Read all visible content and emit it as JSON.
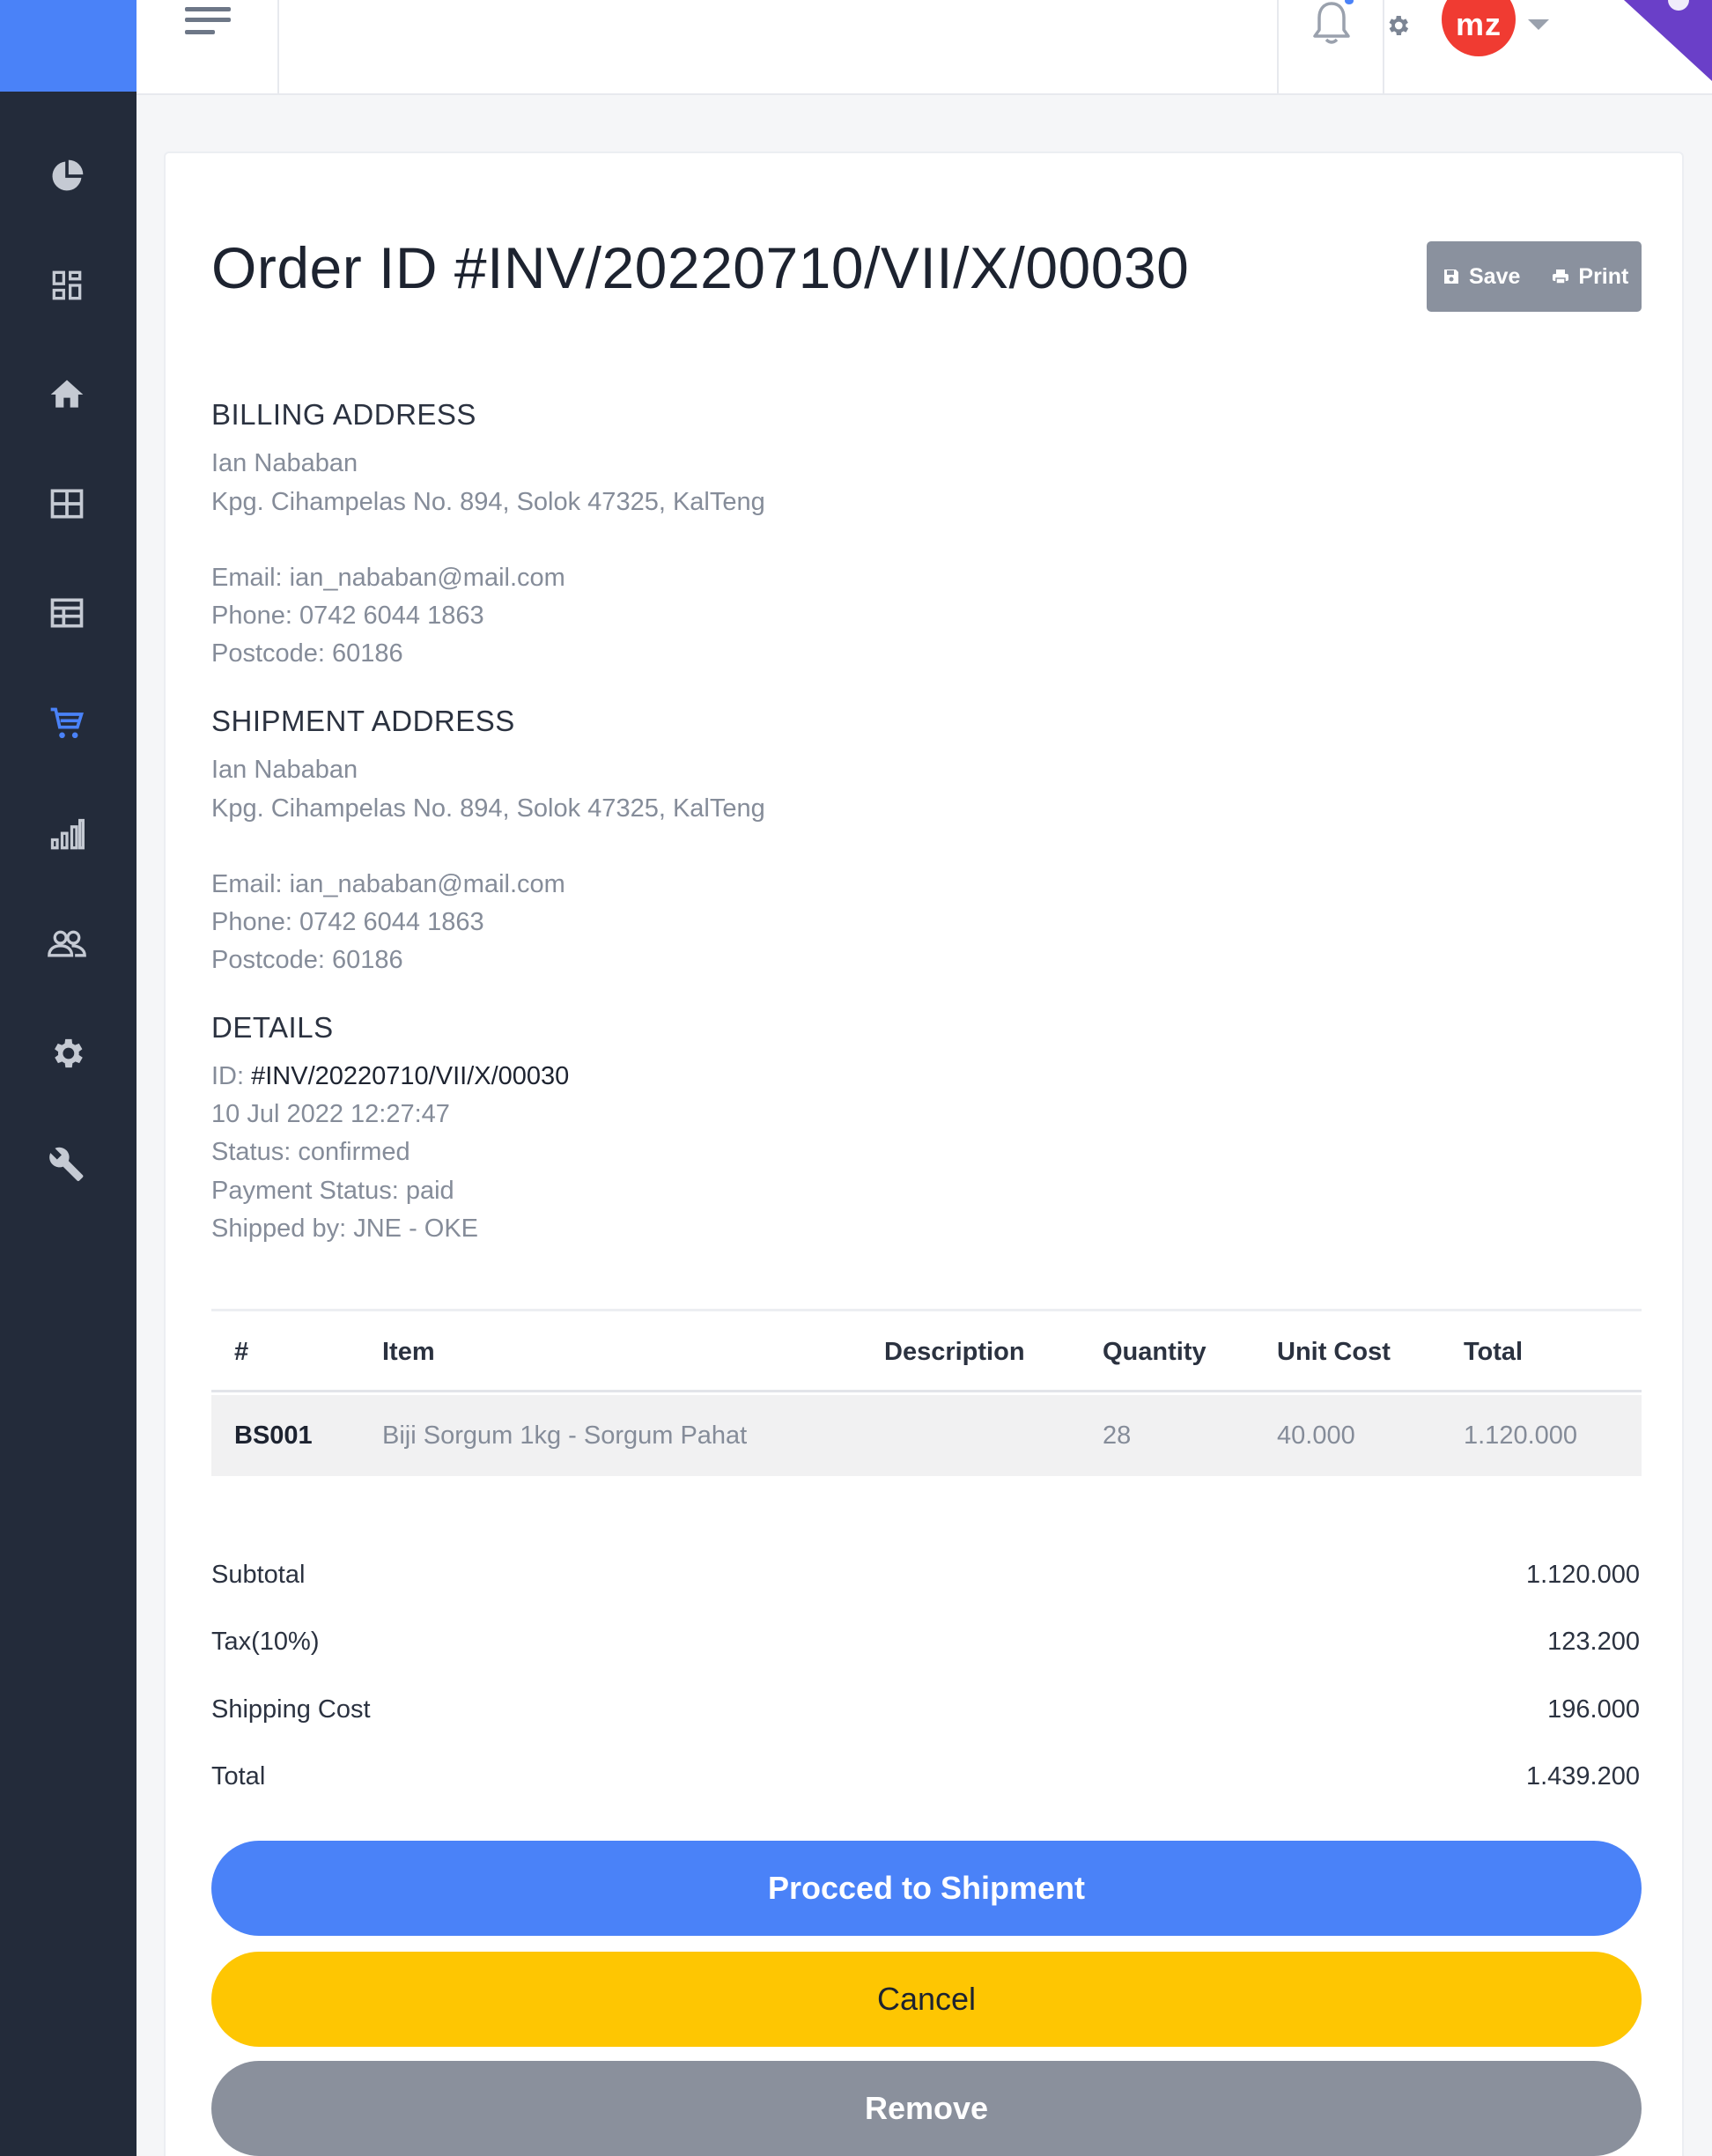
{
  "topbar": {
    "avatar_initials": "mz",
    "notification_dot": true
  },
  "sidebar": {
    "items": [
      {
        "icon": "pie-chart-icon",
        "active": false
      },
      {
        "icon": "dashboard-icon",
        "active": false
      },
      {
        "icon": "home-icon",
        "active": false
      },
      {
        "icon": "grid-icon",
        "active": false
      },
      {
        "icon": "layout-icon",
        "active": false
      },
      {
        "icon": "cart-icon",
        "active": true
      },
      {
        "icon": "bar-chart-icon",
        "active": false
      },
      {
        "icon": "users-icon",
        "active": false
      },
      {
        "icon": "gear-icon",
        "active": false
      },
      {
        "icon": "wrench-icon",
        "active": false
      }
    ]
  },
  "order": {
    "title": "Order ID #INV/20220710/VII/X/00030",
    "save_label": "Save",
    "print_label": "Print"
  },
  "billing": {
    "heading": "BILLING ADDRESS",
    "name": "Ian Nababan",
    "address": "Kpg. Cihampelas No. 894, Solok 47325, KalTeng",
    "email": "Email: ian_nababan@mail.com",
    "phone": "Phone: 0742 6044 1863",
    "postcode": "Postcode: 60186"
  },
  "shipment": {
    "heading": "SHIPMENT ADDRESS",
    "name": "Ian Nababan",
    "address": "Kpg. Cihampelas No. 894, Solok 47325, KalTeng",
    "email": "Email: ian_nababan@mail.com",
    "phone": "Phone: 0742 6044 1863",
    "postcode": "Postcode: 60186"
  },
  "details": {
    "heading": "DETAILS",
    "id_label": "ID: ",
    "id_value": "#INV/20220710/VII/X/00030",
    "datetime": "10 Jul 2022 12:27:47",
    "status": "Status: confirmed",
    "payment_status": "Payment Status: paid",
    "shipped_by": "Shipped by: JNE - OKE"
  },
  "table": {
    "headers": [
      "#",
      "Item",
      "Description",
      "Quantity",
      "Unit Cost",
      "Total"
    ],
    "rows": [
      {
        "code": "BS001",
        "item": "Biji Sorgum 1kg - Sorgum Pahat",
        "description": "",
        "quantity": "28",
        "unit_cost": "40.000",
        "total": "1.120.000"
      }
    ]
  },
  "summary": {
    "subtotal_label": "Subtotal",
    "subtotal_value": "1.120.000",
    "tax_label": "Tax(10%)",
    "tax_value": "123.200",
    "shipping_label": "Shipping Cost",
    "shipping_value": "196.000",
    "total_label": "Total",
    "total_value": "1.439.200"
  },
  "actions": {
    "proceed": "Procced to Shipment",
    "cancel": "Cancel",
    "remove": "Remove"
  },
  "colors": {
    "primary": "#4a82f8",
    "warning": "#fec602",
    "neutral": "#8a909c",
    "sidebar": "#232b3a",
    "avatar": "#f03b32"
  }
}
